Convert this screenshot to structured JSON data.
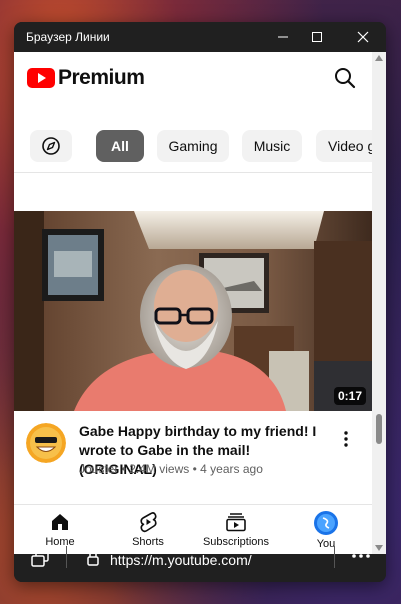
{
  "window": {
    "title": "Браузер Линии"
  },
  "header": {
    "brand": "Premium"
  },
  "chips": [
    {
      "label": "All",
      "active": true
    },
    {
      "label": "Gaming",
      "active": false
    },
    {
      "label": "Music",
      "active": false
    },
    {
      "label": "Video g",
      "active": false
    }
  ],
  "video": {
    "duration": "0:17",
    "title": "Gabe Happy birthday to my friend! I wrote to Gabe in the mail! (ORIGINAL)",
    "channel": "Jouster",
    "views": "2.4M views",
    "age": "4 years ago",
    "sub_sep": "•"
  },
  "nav": [
    {
      "label": "Home",
      "icon": "home-icon"
    },
    {
      "label": "Shorts",
      "icon": "shorts-icon"
    },
    {
      "label": "Subscriptions",
      "icon": "subscriptions-icon"
    },
    {
      "label": "You",
      "icon": "you-avatar"
    }
  ],
  "address": {
    "url": "https://m.youtube.com/"
  },
  "colors": {
    "youtube_red": "#ff0000",
    "chip_active": "#606060",
    "chip_bg": "#f2f2f2"
  }
}
